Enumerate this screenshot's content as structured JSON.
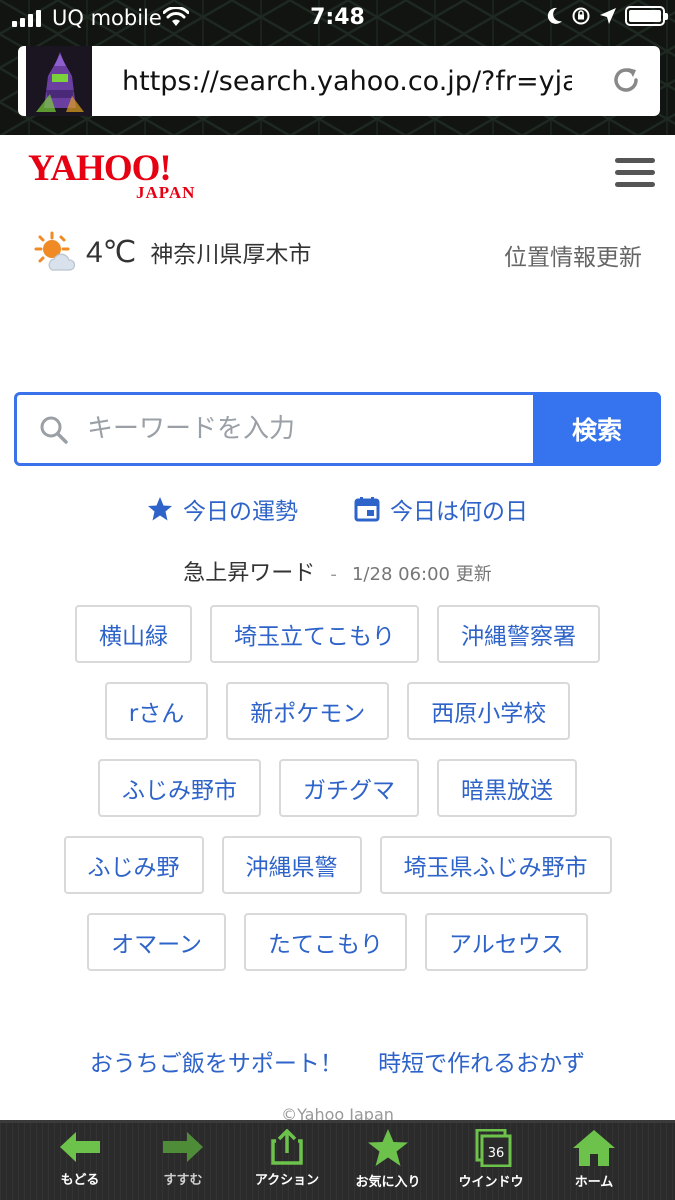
{
  "status_bar": {
    "carrier": "UQ mobile",
    "time": "7:48"
  },
  "browser": {
    "url": "https://search.yahoo.co.jp/?fr=yjapp…"
  },
  "header": {
    "logo_main": "YAHOO!",
    "logo_sub": "JAPAN"
  },
  "weather": {
    "temperature": "4℃",
    "location": "神奈川県厚木市",
    "update_link": "位置情報更新"
  },
  "search": {
    "placeholder": "キーワードを入力",
    "button_label": "検索"
  },
  "quick_links": [
    {
      "label": "今日の運勢",
      "icon": "star-icon"
    },
    {
      "label": "今日は何の日",
      "icon": "calendar-icon"
    }
  ],
  "trending": {
    "title": "急上昇ワード",
    "separator": "-",
    "updated": "1/28 06:00 更新",
    "rows": [
      [
        "横山緑",
        "埼玉立てこもり",
        "沖縄警察署"
      ],
      [
        "rさん",
        "新ポケモン",
        "西原小学校"
      ],
      [
        "ふじみ野市",
        "ガチグマ",
        "暗黒放送"
      ],
      [
        "ふじみ野",
        "沖縄県警",
        "埼玉県ふじみ野市"
      ],
      [
        "オマーン",
        "たてこもり",
        "アルセウス"
      ]
    ]
  },
  "promo": {
    "left": "おうちご飯をサポート！",
    "right": "時短で作れるおかず"
  },
  "footer": {
    "copyright": "©Yahoo Japan"
  },
  "toolbar": {
    "back": "もどる",
    "forward": "すすむ",
    "action": "アクション",
    "favorites": "お気に入り",
    "window": "ウインドウ",
    "window_count": "36",
    "home": "ホーム"
  },
  "colors": {
    "link": "#2e63c9",
    "search_accent": "#3574ee",
    "yahoo_red": "#e60012",
    "toolbar_green": "#6cc24a"
  }
}
